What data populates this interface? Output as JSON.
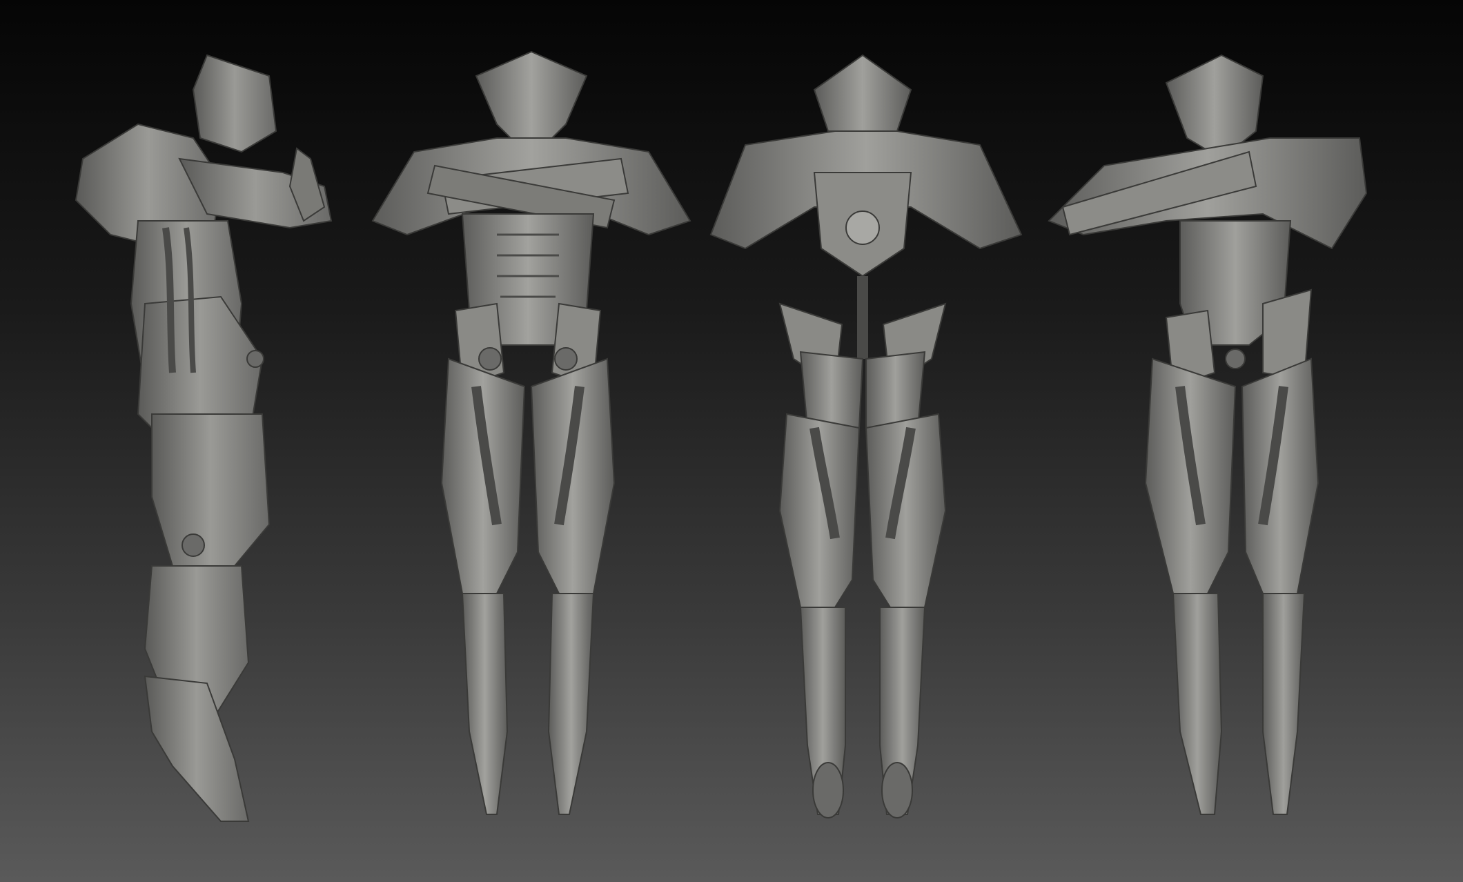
{
  "scene": {
    "description_label": "",
    "material_color": "#8a8a88",
    "shadow_color": "#4a4a48",
    "highlight_color": "#b4b4b0",
    "background_top": "#050505",
    "background_bottom": "#5a5a5a"
  },
  "views": [
    {
      "view": "side-left"
    },
    {
      "view": "front"
    },
    {
      "view": "back"
    },
    {
      "view": "three-quarter"
    }
  ]
}
